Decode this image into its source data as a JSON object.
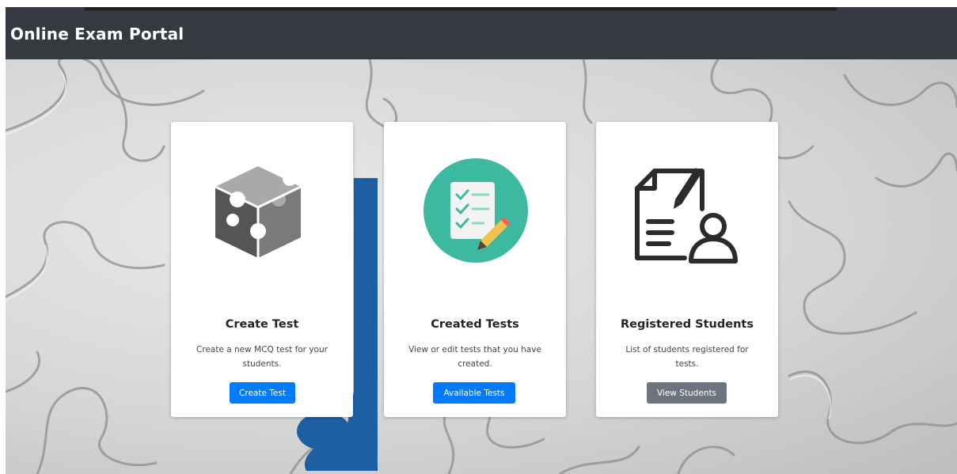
{
  "navbar": {
    "brand": "Online Exam Portal"
  },
  "colors": {
    "navbar_bg": "#343a40",
    "primary": "#007bff",
    "secondary": "#6c757d",
    "teal_circle": "#3db9a2"
  },
  "cards": [
    {
      "icon": "puzzle-cube-icon",
      "title": "Create Test",
      "text": "Create a new MCQ test for your students.",
      "button": "Create Test"
    },
    {
      "icon": "checklist-icon",
      "title": "Created Tests",
      "text": "View or edit tests that you have created.",
      "button": "Available Tests"
    },
    {
      "icon": "document-user-icon",
      "title": "Registered Students",
      "text": "List of students registered for tests.",
      "button": "View Students"
    }
  ]
}
